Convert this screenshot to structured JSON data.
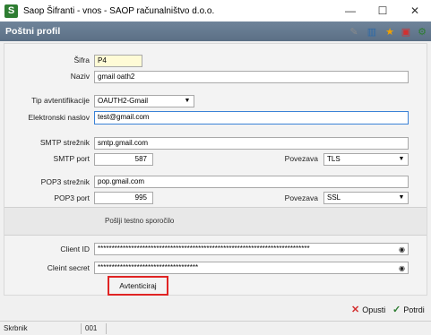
{
  "window": {
    "title": "Saop Šifranti - vnos - SAOP računalništvo d.o.o.",
    "app_icon_letter": "S",
    "minimize": "—",
    "maximize": "☐",
    "close": "✕"
  },
  "header": {
    "title": "Poštni profil"
  },
  "toolbar_icons": [
    "edit-icon",
    "columns-icon",
    "star-icon",
    "pdf-icon",
    "settings-icon"
  ],
  "form": {
    "sifra": {
      "label": "Šifra",
      "value": "P4"
    },
    "naziv": {
      "label": "Naziv",
      "value": "gmail oath2"
    },
    "tip": {
      "label": "Tip avtentifikacije",
      "value": "OAUTH2-Gmail"
    },
    "email": {
      "label": "Elektronski naslov",
      "value": "test@gmail.com"
    },
    "smtp_server": {
      "label": "SMTP strežnik",
      "value": "smtp.gmail.com"
    },
    "smtp_port": {
      "label": "SMTP port",
      "value": "587"
    },
    "smtp_conn": {
      "label": "Povezava",
      "value": "TLS"
    },
    "pop3_server": {
      "label": "POP3 strežnik",
      "value": "pop.gmail.com"
    },
    "pop3_port": {
      "label": "POP3 port",
      "value": "995"
    },
    "pop3_conn": {
      "label": "Povezava",
      "value": "SSL"
    },
    "test_mail": "Pošlji testno sporočilo",
    "client_id": {
      "label": "Client ID",
      "value": "****************************************************************************"
    },
    "client_secret": {
      "label": "Cleint secret",
      "value": "************************************"
    },
    "auth_button": "Avtenticiraj"
  },
  "buttons": {
    "cancel": "Opusti",
    "confirm": "Potrdi"
  },
  "statusbar": {
    "user": "Skrbnik",
    "code": "001"
  },
  "colors": {
    "header_bg": "#5f7389",
    "highlight_border": "#e02424",
    "focus_border": "#3b82d6",
    "cancel_icon": "#d32f2f",
    "confirm_icon": "#2e7d32"
  }
}
